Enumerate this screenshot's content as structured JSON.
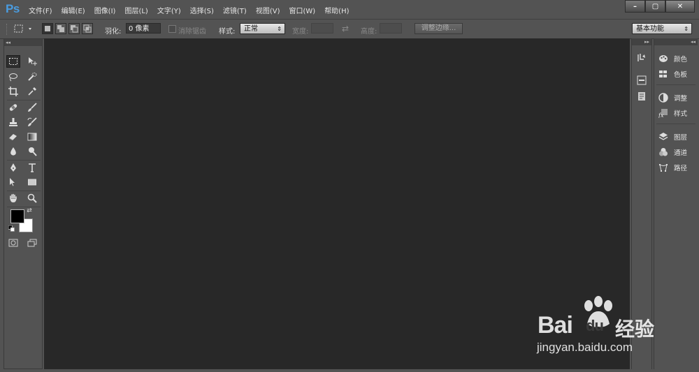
{
  "app": {
    "logo": "Ps"
  },
  "menu": [
    "文件(F)",
    "编辑(E)",
    "图像(I)",
    "图层(L)",
    "文字(Y)",
    "选择(S)",
    "滤镜(T)",
    "视图(V)",
    "窗口(W)",
    "帮助(H)"
  ],
  "window_controls": {
    "minimize": "–",
    "maximize": "▢",
    "close": "✕"
  },
  "options": {
    "feather_label": "羽化:",
    "feather_value": "0 像素",
    "antialias_label": "消除锯齿",
    "style_label": "样式:",
    "style_value": "正常",
    "width_label": "宽度:",
    "height_label": "高度:",
    "refine_edge": "调整边缘...",
    "workspace": "基本功能"
  },
  "panels": {
    "group1": [
      "颜色",
      "色板"
    ],
    "group2": [
      "调整",
      "样式"
    ],
    "group3": [
      "图层",
      "通道",
      "路径"
    ]
  },
  "watermark": {
    "brand": "Bai",
    "brand_suffix": "du",
    "cn": "经验",
    "url": "jingyan.baidu.com"
  },
  "colors": {
    "foreground": "#000000",
    "background": "#ffffff",
    "canvas": "#282828",
    "ui": "#535353",
    "logo": "#4a9ce0"
  }
}
